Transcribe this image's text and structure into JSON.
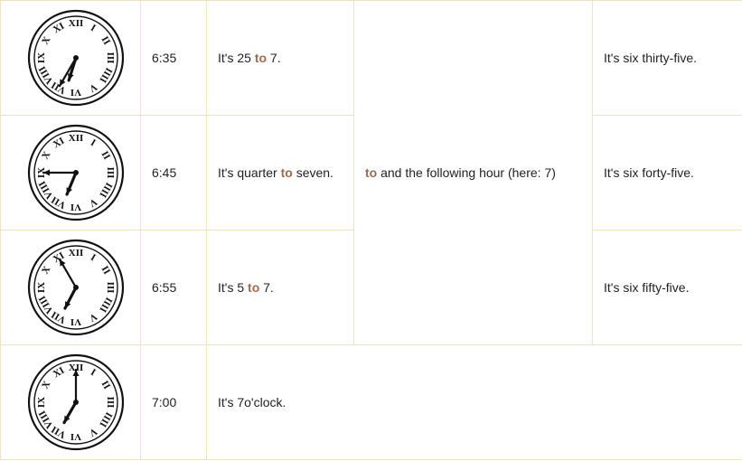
{
  "rows": [
    {
      "time": "6:35",
      "expression": {
        "before": "It's 25 ",
        "keyword": "to",
        "after": " 7."
      },
      "spoken": "It's six thirty-five.",
      "clock": {
        "hour": 6,
        "minute": 35
      }
    },
    {
      "time": "6:45",
      "expression": {
        "before": "It's quarter ",
        "keyword": "to",
        "after": " seven."
      },
      "spoken": "It's six forty-five.",
      "clock": {
        "hour": 6,
        "minute": 45
      }
    },
    {
      "time": "6:55",
      "expression": {
        "before": "It's 5 ",
        "keyword": "to",
        "after": " 7."
      },
      "spoken": "It's six fifty-five.",
      "clock": {
        "hour": 6,
        "minute": 55
      }
    },
    {
      "time": "7:00",
      "expression": {
        "before": "It's 7o'clock.",
        "keyword": "",
        "after": ""
      },
      "clock": {
        "hour": 7,
        "minute": 0
      }
    }
  ],
  "rule": {
    "keyword": "to",
    "text": " and the following hour (here: 7)"
  },
  "numerals": [
    "XII",
    "I",
    "II",
    "III",
    "IIII",
    "V",
    "VI",
    "VII",
    "VIII",
    "IX",
    "X",
    "XI"
  ],
  "colors": {
    "border": "#f0e2c2",
    "highlight": "#a06a50"
  }
}
